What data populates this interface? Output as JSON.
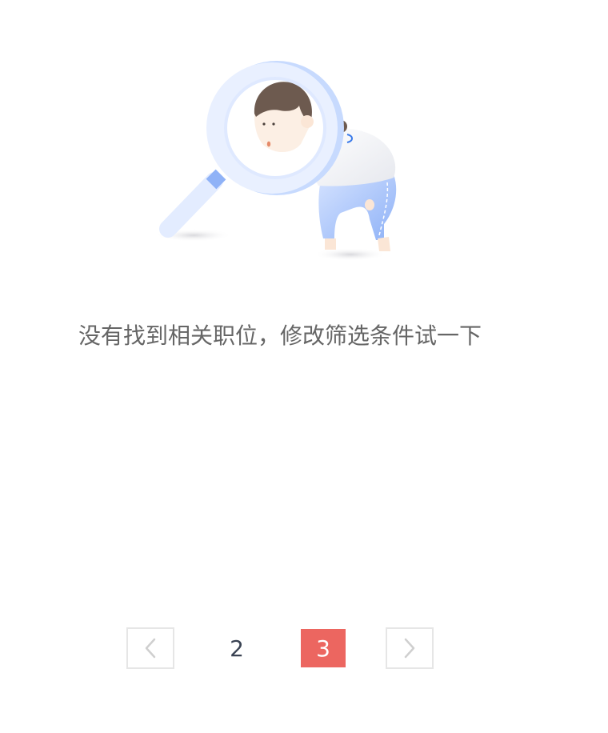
{
  "empty_state": {
    "illustration": "magnifier-person-illustration",
    "message": "没有找到相关职位，修改筛选条件试一下"
  },
  "pagination": {
    "prev_icon": "chevron-left-icon",
    "next_icon": "chevron-right-icon",
    "pages": [
      "2",
      "3"
    ],
    "current_page": "3",
    "active_color": "#ec6660",
    "text_color": "#3a4353",
    "border_color": "#e6e6e6"
  }
}
